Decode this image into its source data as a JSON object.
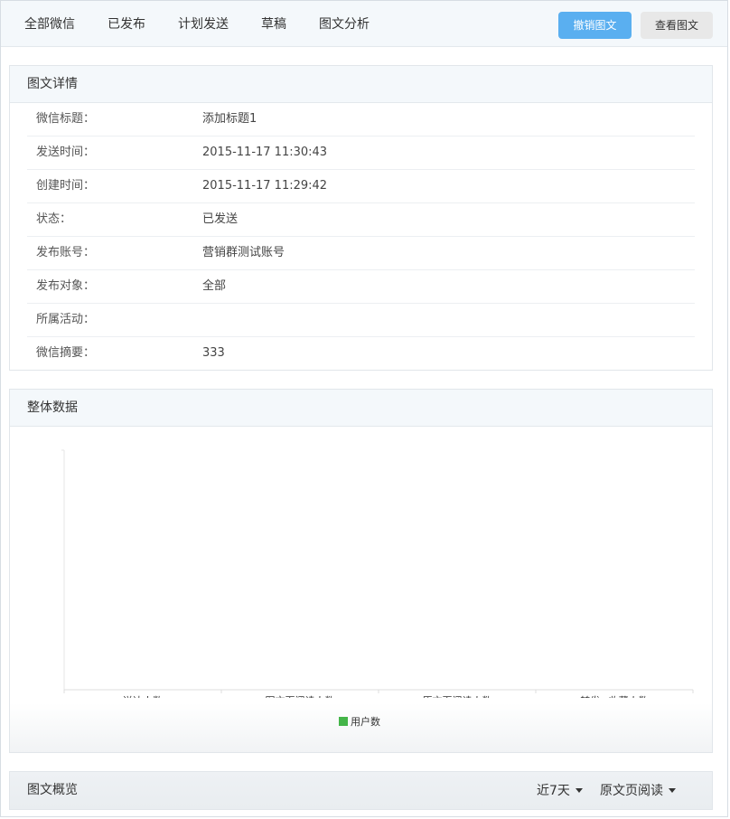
{
  "nav": {
    "tabs": [
      "全部微信",
      "已发布",
      "计划发送",
      "草稿",
      "图文分析"
    ],
    "revoke_button": "撤销图文",
    "view_button": "查看图文"
  },
  "details": {
    "title": "图文详情",
    "rows": [
      {
        "label": "微信标题：",
        "value": "添加标题1"
      },
      {
        "label": "发送时间：",
        "value": "2015-11-17 11:30:43"
      },
      {
        "label": "创建时间：",
        "value": "2015-11-17 11:29:42"
      },
      {
        "label": "状态：",
        "value": "已发送"
      },
      {
        "label": "发布账号：",
        "value": "营销群测试账号"
      },
      {
        "label": "发布对象：",
        "value": "全部"
      },
      {
        "label": "所属活动：",
        "value": ""
      },
      {
        "label": "微信摘要：",
        "value": "333"
      }
    ]
  },
  "overall": {
    "title": "整体数据"
  },
  "chart_data": {
    "type": "bar",
    "categories": [
      "送达人数",
      "图文页阅读人数",
      "原文页阅读人数",
      "转发+收藏人数"
    ],
    "series": [
      {
        "name": "用户数",
        "values": [
          0,
          0,
          0,
          0
        ],
        "color": "#44b549"
      }
    ],
    "title": "",
    "xlabel": "",
    "ylabel": "",
    "grid": false,
    "legend": "bottom-center"
  },
  "overview": {
    "title": "图文概览",
    "range_select": "近7天",
    "metric_select": "原文页阅读"
  }
}
